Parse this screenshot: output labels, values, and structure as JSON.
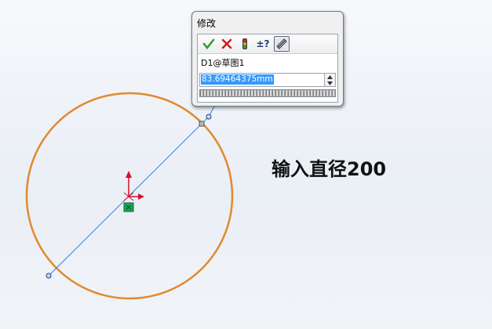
{
  "dialog": {
    "title": "修改",
    "toolbar": {
      "icons": [
        "check-icon",
        "cross-icon",
        "rebuild-icon",
        "tolerance-icon",
        "mark-dimension-icon"
      ],
      "tolerance_label": "±?"
    },
    "dimension_name": "D1@草图1",
    "value": "83.69464375mm"
  },
  "annotation": "输入直径200",
  "colors": {
    "circle": "#e08a2c",
    "diameter_line": "#3a7fd5",
    "accept": "#2ea12e",
    "reject": "#cf2020",
    "origin_red": "#d4112a",
    "center_green": "#19a35a",
    "selection": "#3399ff"
  }
}
